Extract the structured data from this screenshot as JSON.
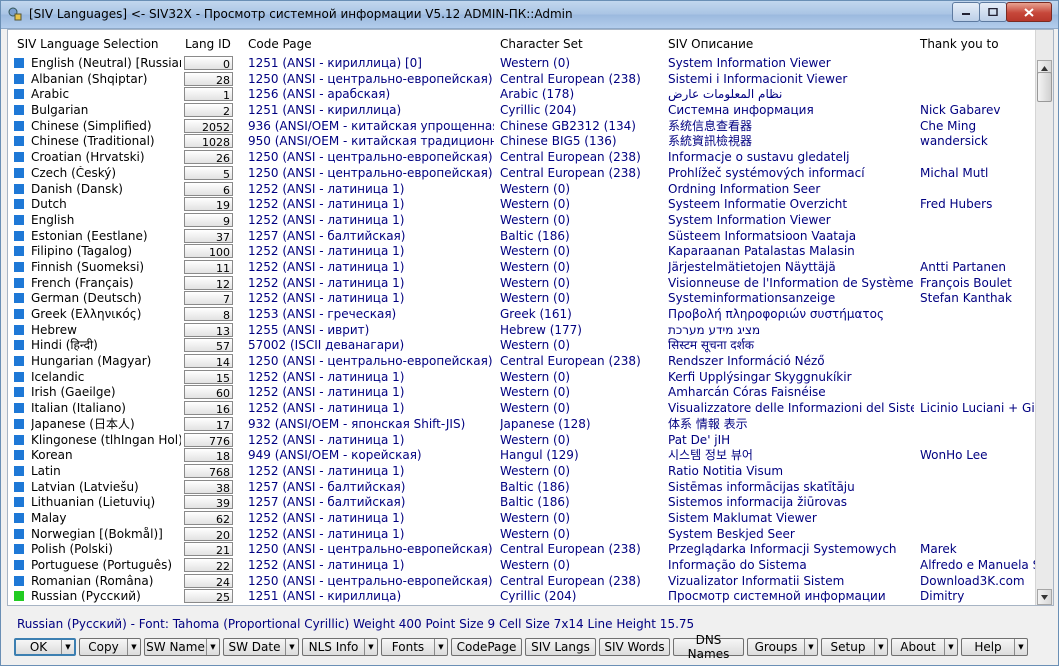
{
  "window": {
    "title": "[SIV Languages] <- SIV32X - Просмотр системной информации V5.12 ADMIN-ПК::Admin"
  },
  "columns": {
    "language": "SIV Language Selection",
    "lang_id": "Lang ID",
    "code_page": "Code Page",
    "charset": "Character Set",
    "description": "SIV Описание",
    "thanks": "Thank you to"
  },
  "rows": [
    {
      "name": "English (Neutral) [Russian]",
      "id": "0",
      "cp": "1251  (ANSI - кириллица) [0]",
      "cs": "Western (0)",
      "desc": "System Information Viewer",
      "thx": ""
    },
    {
      "name": "Albanian (Shqiptar)",
      "id": "28",
      "cp": "1250  (ANSI - центрально-европейская)",
      "cs": "Central European (238)",
      "desc": "Sistemi i Informacionit Viewer",
      "thx": ""
    },
    {
      "name": "Arabic",
      "id": "1",
      "cp": "1256  (ANSI - арабская)",
      "cs": "Arabic (178)",
      "desc": "نظام المعلومات عارض",
      "thx": ""
    },
    {
      "name": "Bulgarian",
      "id": "2",
      "cp": "1251  (ANSI - кириллица)",
      "cs": "Cyrillic (204)",
      "desc": "Системна информация",
      "thx": "Nick Gabarev"
    },
    {
      "name": "Chinese (Simplified)",
      "id": "2052",
      "cp": "936   (ANSI/OEM - китайская упрощенная GBK)",
      "cs": "Chinese GB2312 (134)",
      "desc": "系统信息查看器",
      "thx": "Che Ming"
    },
    {
      "name": "Chinese (Traditional)",
      "id": "1028",
      "cp": "950   (ANSI/OEM - китайская традиционная Big5)",
      "cs": "Chinese BIG5 (136)",
      "desc": "系統資訊檢視器",
      "thx": "wandersick"
    },
    {
      "name": "Croatian (Hrvatski)",
      "id": "26",
      "cp": "1250  (ANSI - центрально-европейская)",
      "cs": "Central European (238)",
      "desc": "Informacje o sustavu gledatelj",
      "thx": ""
    },
    {
      "name": "Czech (Český)",
      "id": "5",
      "cp": "1250  (ANSI - центрально-европейская)",
      "cs": "Central European (238)",
      "desc": "Prohlížeč systémových informací",
      "thx": "Michal Mutl"
    },
    {
      "name": "Danish (Dansk)",
      "id": "6",
      "cp": "1252  (ANSI - латиница 1)",
      "cs": "Western (0)",
      "desc": "Ordning Information Seer",
      "thx": ""
    },
    {
      "name": "Dutch",
      "id": "19",
      "cp": "1252  (ANSI - латиница 1)",
      "cs": "Western (0)",
      "desc": "Systeem Informatie Overzicht",
      "thx": "Fred Hubers"
    },
    {
      "name": "English",
      "id": "9",
      "cp": "1252  (ANSI - латиница 1)",
      "cs": "Western (0)",
      "desc": "System Information Viewer",
      "thx": ""
    },
    {
      "name": "Estonian (Eestlane)",
      "id": "37",
      "cp": "1257  (ANSI - балтийская)",
      "cs": "Baltic (186)",
      "desc": "Süsteem Informatsioon Vaataja",
      "thx": ""
    },
    {
      "name": "Filipino (Tagalog)",
      "id": "100",
      "cp": "1252  (ANSI - латиница 1)",
      "cs": "Western (0)",
      "desc": "Kaparaanan Patalastas Malasin",
      "thx": ""
    },
    {
      "name": "Finnish (Suomeksi)",
      "id": "11",
      "cp": "1252  (ANSI - латиница 1)",
      "cs": "Western (0)",
      "desc": "Järjestelmätietojen Näyttäjä",
      "thx": "Antti Partanen"
    },
    {
      "name": "French (Français)",
      "id": "12",
      "cp": "1252  (ANSI - латиница 1)",
      "cs": "Western (0)",
      "desc": "Visionneuse de l'Information de Système",
      "thx": "François Boulet"
    },
    {
      "name": "German (Deutsch)",
      "id": "7",
      "cp": "1252  (ANSI - латиница 1)",
      "cs": "Western (0)",
      "desc": "Systeminformationsanzeige",
      "thx": "Stefan Kanthak"
    },
    {
      "name": "Greek (Ελληνικός)",
      "id": "8",
      "cp": "1253  (ANSI - греческая)",
      "cs": "Greek (161)",
      "desc": "Προβολή πληροφοριών συστήματος",
      "thx": ""
    },
    {
      "name": "Hebrew",
      "id": "13",
      "cp": "1255  (ANSI - иврит)",
      "cs": "Hebrew (177)",
      "desc": "מציג מידע מערכת",
      "thx": ""
    },
    {
      "name": "Hindi (हिन्दी)",
      "id": "57",
      "cp": "57002 (ISCII деванагари)",
      "cs": "Western (0)",
      "desc": "सिस्टम सूचना दर्शक",
      "thx": ""
    },
    {
      "name": "Hungarian (Magyar)",
      "id": "14",
      "cp": "1250  (ANSI - центрально-европейская)",
      "cs": "Central European (238)",
      "desc": "Rendszer Információ Néző",
      "thx": ""
    },
    {
      "name": "Icelandic",
      "id": "15",
      "cp": "1252  (ANSI - латиница 1)",
      "cs": "Western (0)",
      "desc": "Kerfi Upplýsingar Skyggnukíkir",
      "thx": ""
    },
    {
      "name": "Irish (Gaeilge)",
      "id": "60",
      "cp": "1252  (ANSI - латиница 1)",
      "cs": "Western (0)",
      "desc": "Amharcán Córas Faisnéise",
      "thx": ""
    },
    {
      "name": "Italian (Italiano)",
      "id": "16",
      "cp": "1252  (ANSI - латиница 1)",
      "cs": "Western (0)",
      "desc": "Visualizzatore delle Informazioni del Sistema",
      "thx": "Licinio Luciani + Giacomo"
    },
    {
      "name": "Japanese (日本人)",
      "id": "17",
      "cp": "932   (ANSI/OEM - японская Shift-JIS)",
      "cs": "Japanese (128)",
      "desc": "体系 情報 表示",
      "thx": ""
    },
    {
      "name": "Klingonese (tlhIngan Hol)",
      "id": "776",
      "cp": "1252  (ANSI - латиница 1)",
      "cs": "Western (0)",
      "desc": "Pat De' jIH",
      "thx": ""
    },
    {
      "name": "Korean",
      "id": "18",
      "cp": "949   (ANSI/OEM - корейская)",
      "cs": "Hangul (129)",
      "desc": "시스템 정보 뷰어",
      "thx": "WonHo Lee"
    },
    {
      "name": "Latin",
      "id": "768",
      "cp": "1252  (ANSI - латиница 1)",
      "cs": "Western (0)",
      "desc": "Ratio Notitia Visum",
      "thx": ""
    },
    {
      "name": "Latvian (Latviešu)",
      "id": "38",
      "cp": "1257  (ANSI - балтийская)",
      "cs": "Baltic (186)",
      "desc": "Sistēmas informācijas skatītāju",
      "thx": ""
    },
    {
      "name": "Lithuanian (Lietuvių)",
      "id": "39",
      "cp": "1257  (ANSI - балтийская)",
      "cs": "Baltic (186)",
      "desc": "Sistemos informacija žiūrovas",
      "thx": ""
    },
    {
      "name": "Malay",
      "id": "62",
      "cp": "1252  (ANSI - латиница 1)",
      "cs": "Western (0)",
      "desc": "Sistem Maklumat Viewer",
      "thx": ""
    },
    {
      "name": "Norwegian [(Bokmål)]",
      "id": "20",
      "cp": "1252  (ANSI - латиница 1)",
      "cs": "Western (0)",
      "desc": "System Beskjed Seer",
      "thx": ""
    },
    {
      "name": "Polish (Polski)",
      "id": "21",
      "cp": "1250  (ANSI - центрально-европейская)",
      "cs": "Central European (238)",
      "desc": "Przeglądarka Informacji Systemowych",
      "thx": "Marek"
    },
    {
      "name": "Portuguese (Português)",
      "id": "22",
      "cp": "1252  (ANSI - латиница 1)",
      "cs": "Western (0)",
      "desc": "Informação do Sistema",
      "thx": "Alfredo e Manuela Santos"
    },
    {
      "name": "Romanian (Româna)",
      "id": "24",
      "cp": "1250  (ANSI - центрально-европейская)",
      "cs": "Central European (238)",
      "desc": "Vizualizator Informatii Sistem",
      "thx": "Download3K.com"
    },
    {
      "name": "Russian (Русский)",
      "id": "25",
      "cp": "1251  (ANSI - кириллица)",
      "cs": "Cyrillic (204)",
      "desc": "Просмотр системной информации",
      "thx": "Dimitry",
      "selected": true
    }
  ],
  "status": "Russian (Русский) - Font: Tahoma (Proportional Cyrillic)  Weight 400  Point Size 9  Cell Size 7x14  Line Height 15.75",
  "buttons": [
    {
      "label": "OK",
      "dd": true,
      "w": 62
    },
    {
      "label": "Copy",
      "dd": true,
      "w": 62
    },
    {
      "label": "SW Name",
      "dd": true,
      "w": 76
    },
    {
      "label": "SW Date",
      "dd": true,
      "w": 76
    },
    {
      "label": "NLS Info",
      "dd": true,
      "w": 76
    },
    {
      "label": "Fonts",
      "dd": true,
      "w": 67
    },
    {
      "label": "CodePage",
      "dd": false,
      "w": 71
    },
    {
      "label": "SIV Langs",
      "dd": false,
      "w": 71
    },
    {
      "label": "SIV Words",
      "dd": false,
      "w": 71
    },
    {
      "label": "DNS Names",
      "dd": false,
      "w": 71
    },
    {
      "label": "Groups",
      "dd": true,
      "w": 71
    },
    {
      "label": "Setup",
      "dd": true,
      "w": 67
    },
    {
      "label": "About",
      "dd": true,
      "w": 67
    },
    {
      "label": "Help",
      "dd": true,
      "w": 67
    }
  ],
  "colors": {
    "square": "#1e78d6",
    "selected_square": "#22cc22",
    "value_text": "#000080"
  }
}
